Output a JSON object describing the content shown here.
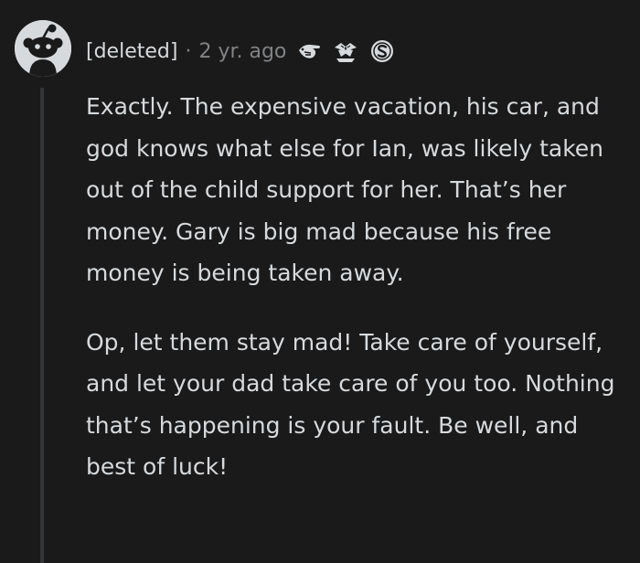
{
  "comment": {
    "author": "[deleted]",
    "separator": "·",
    "timestamp": "2 yr. ago",
    "awards": [
      "pointing-hand-award-icon",
      "fist-bump-award-icon",
      "silver-coin-award-icon"
    ],
    "paragraphs": [
      "Exactly. The expensive vacation, his car, and god knows what else for Ian, was likely taken out of the child support for her. That’s her money. Gary is big mad because his free money is being taken away.",
      "Op, let them stay mad! Take care of yourself, and let your dad take care of you too. Nothing that’s happening is your fault. Be well, and best of luck!"
    ]
  },
  "colors": {
    "background": "#1a1a1b",
    "text": "#d7dadc",
    "muted": "#818384",
    "thread_line": "#343536"
  }
}
